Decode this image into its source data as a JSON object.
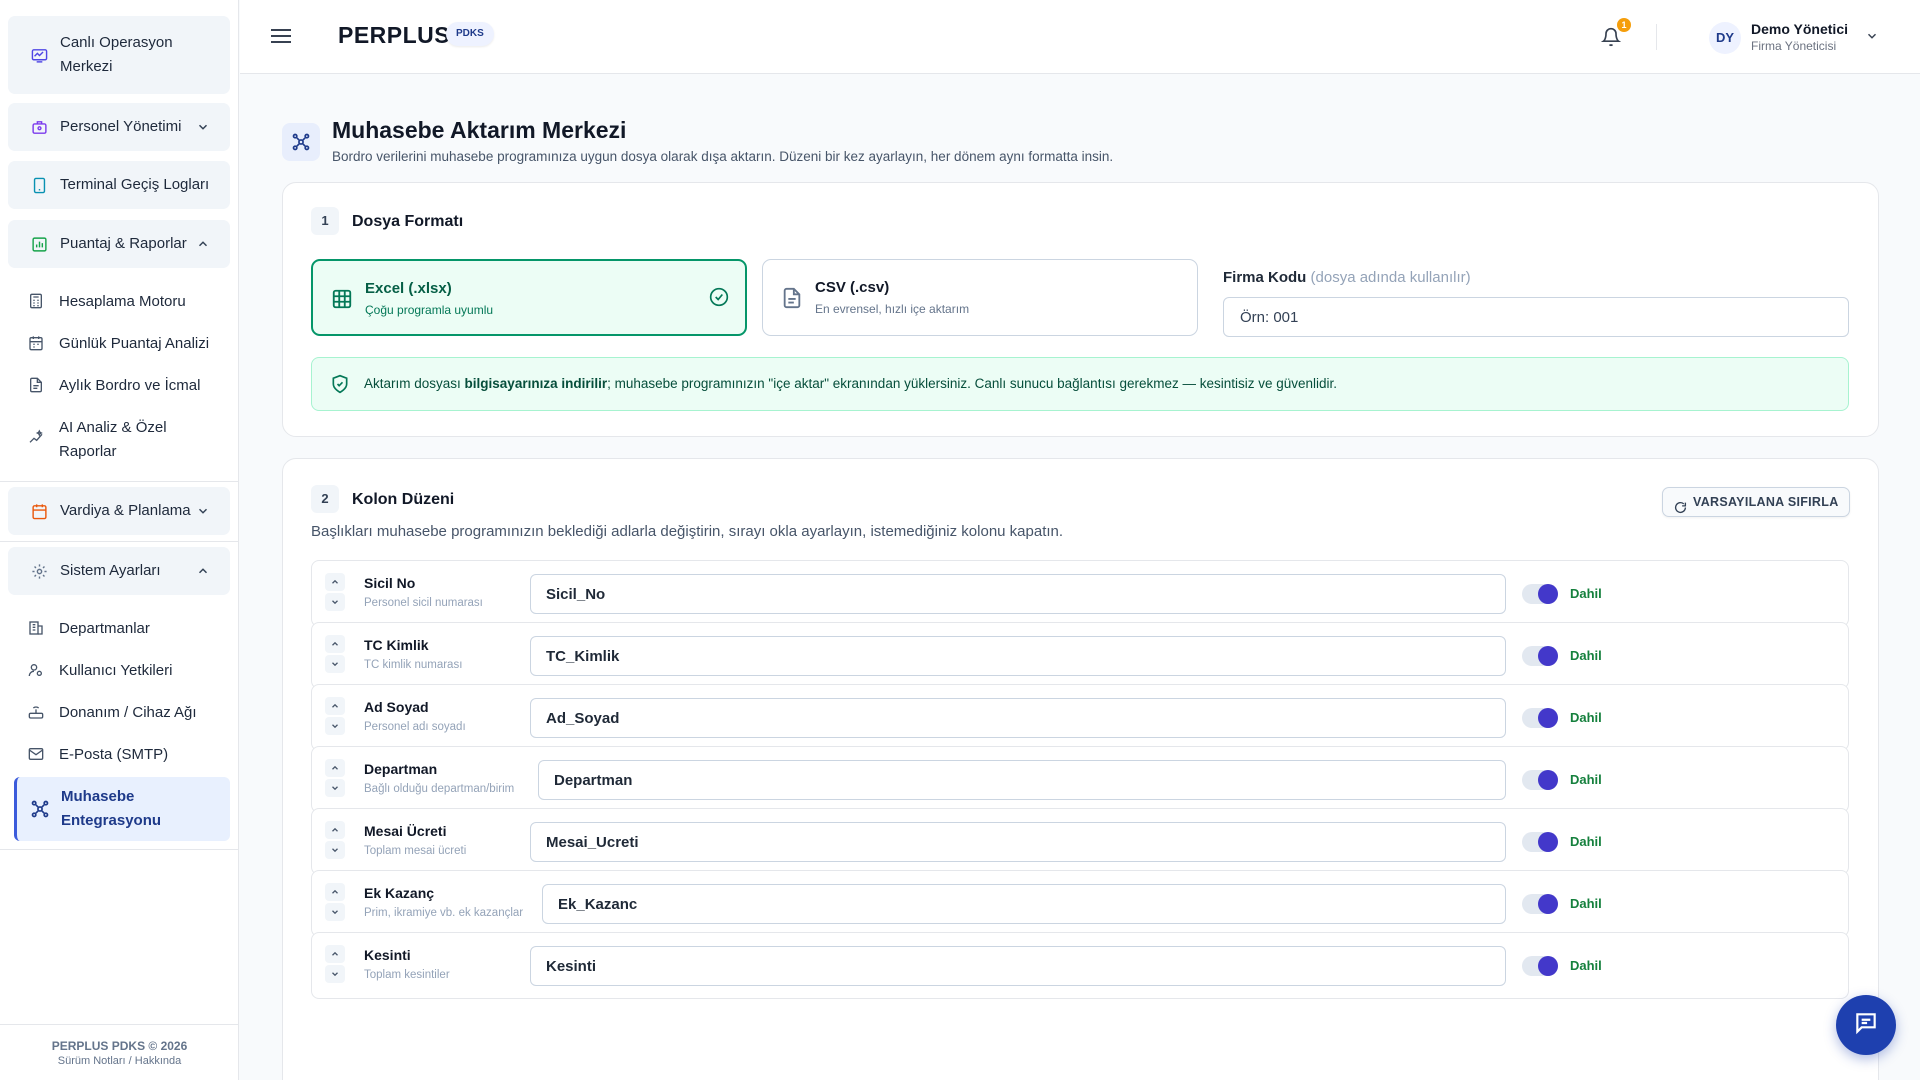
{
  "sidebar": {
    "groups": [
      {
        "label": "Canlı Operasyon Merkezi",
        "icon": "monitor-icon"
      },
      {
        "label": "Personel Yönetimi",
        "icon": "briefcase-icon"
      },
      {
        "label": "Terminal Geçiş Logları",
        "icon": "tablet-icon"
      },
      {
        "label": "Puantaj & Raporlar",
        "icon": "bar-chart-icon"
      },
      {
        "label": "Vardiya & Planlama",
        "icon": "calendar-icon"
      },
      {
        "label": "Sistem Ayarları",
        "icon": "settings-icon"
      }
    ],
    "reports_items": [
      {
        "label": "Hesaplama Motoru",
        "icon": "calculator-icon"
      },
      {
        "label": "Günlük Puantaj Analizi",
        "icon": "calendar-days-icon"
      },
      {
        "label": "Aylık Bordro ve İcmal",
        "icon": "file-text-icon"
      },
      {
        "label": "AI Analiz & Özel Raporlar",
        "icon": "sparkle-chart-icon"
      }
    ],
    "settings_items": [
      {
        "label": "Departmanlar",
        "icon": "building-icon"
      },
      {
        "label": "Kullanıcı Yetkileri",
        "icon": "user-key-icon"
      },
      {
        "label": "Donanım / Cihaz Ağı",
        "icon": "router-icon"
      },
      {
        "label": "E-Posta (SMTP)",
        "icon": "mail-icon"
      }
    ],
    "active_item": {
      "label": "Muhasebe Entegrasyonu",
      "icon": "network-icon"
    },
    "footer": {
      "line1": "PERPLUS PDKS © 2026",
      "line2": "Sürüm Notları / Hakkında"
    }
  },
  "header": {
    "brand": "PERPLUS",
    "brand_tag": "PDKS",
    "notification_count": "1",
    "user": {
      "initials": "DY",
      "name": "Demo Yönetici",
      "role": "Firma Yöneticisi"
    }
  },
  "page": {
    "title": "Muhasebe Aktarım Merkezi",
    "subtitle": "Bordro verilerini muhasebe programınıza uygun dosya olarak dışa aktarın. Düzeni bir kez ayarlayın, her dönem aynı formatta insin."
  },
  "step1": {
    "number": "1",
    "title": "Dosya Formatı",
    "formats": [
      {
        "title": "Excel (.xlsx)",
        "desc": "Çoğu programla uyumlu",
        "selected": true
      },
      {
        "title": "CSV (.csv)",
        "desc": "En evrensel, hızlı içe aktarım",
        "selected": false
      }
    ],
    "firm_code_label": "Firma Kodu",
    "firm_code_hint": "(dosya adında kullanılır)",
    "firm_code_placeholder": "Örn: 001",
    "note_pre": "Aktarım dosyası ",
    "note_bold": "bilgisayarınıza indirilir",
    "note_post": "; muhasebe programınızın \"içe aktar\" ekranından yüklersiniz. Canlı sunucu bağlantısı gerekmez — kesintisiz ve güvenlidir."
  },
  "step2": {
    "number": "2",
    "title": "Kolon Düzeni",
    "reset_label": "VARSAYILANA SIFIRLA",
    "hint": "Başlıkları muhasebe programınızın beklediği adlarla değiştirin, sırayı okla ayarlayın, istemediğiniz kolonu kapatın.",
    "rows": [
      {
        "name": "Sicil No",
        "desc": "Personel sicil numarası",
        "value": "Sicil_No",
        "state": "Dahil",
        "enabled": true
      },
      {
        "name": "TC Kimlik",
        "desc": "TC kimlik numarası",
        "value": "TC_Kimlik",
        "state": "Dahil",
        "enabled": true
      },
      {
        "name": "Ad Soyad",
        "desc": "Personel adı soyadı",
        "value": "Ad_Soyad",
        "state": "Dahil",
        "enabled": true
      },
      {
        "name": "Departman",
        "desc": "Bağlı olduğu departman/birim",
        "value": "Departman",
        "state": "Dahil",
        "enabled": true
      },
      {
        "name": "Mesai Ücreti",
        "desc": "Toplam mesai ücreti",
        "value": "Mesai_Ucreti",
        "state": "Dahil",
        "enabled": true
      },
      {
        "name": "Ek Kazanç",
        "desc": "Prim, ikramiye vb. ek kazançlar",
        "value": "Ek_Kazanc",
        "state": "Dahil",
        "enabled": true
      },
      {
        "name": "Kesinti",
        "desc": "Toplam kesintiler",
        "value": "Kesinti",
        "state": "Dahil",
        "enabled": true
      }
    ]
  },
  "colors": {
    "brand": "#1e3a8a",
    "accent": "#4338ca",
    "success": "#059669",
    "success_text": "#15803d",
    "badge": "#f59e0b"
  }
}
